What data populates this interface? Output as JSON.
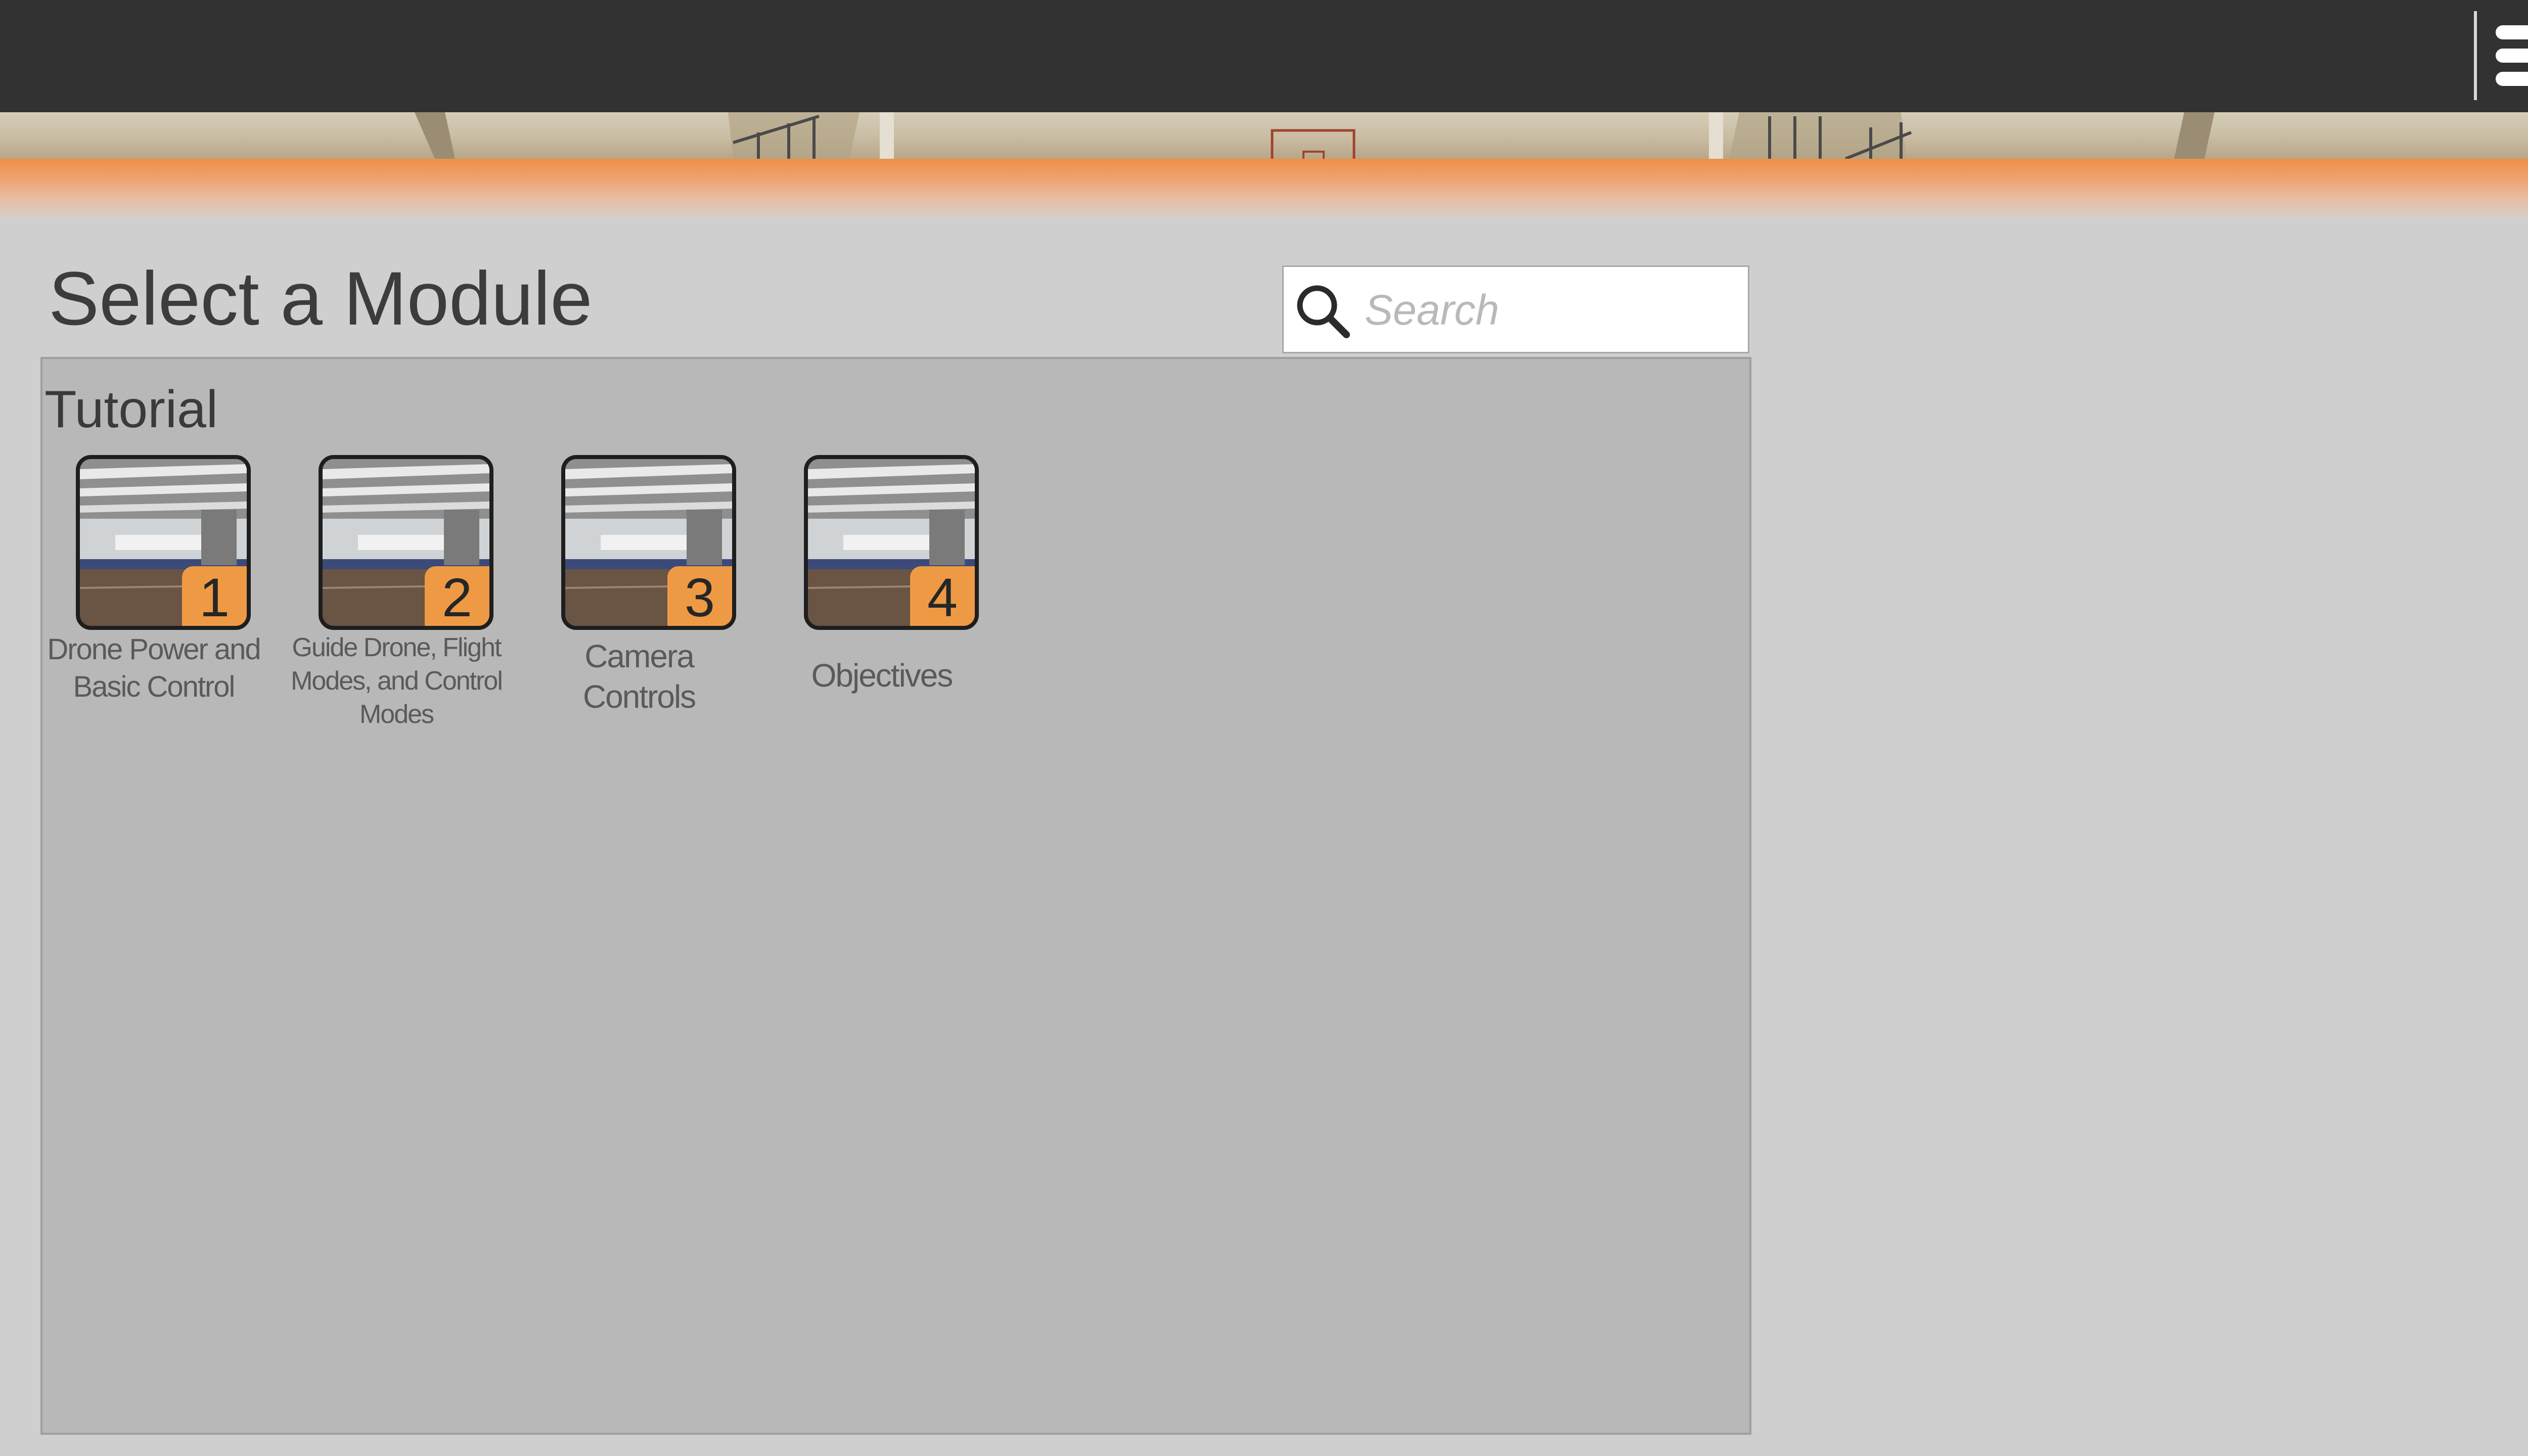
{
  "topbar": {
    "menu_icon": "hamburger-menu-icon"
  },
  "page": {
    "title": "Select a Module"
  },
  "search": {
    "placeholder": "Search",
    "value": "",
    "icon": "search-icon"
  },
  "section": {
    "title": "Tutorial"
  },
  "modules": [
    {
      "number": "1",
      "title": "Drone Power and Basic Control"
    },
    {
      "number": "2",
      "title": "Guide Drone, Flight Modes, and Control Modes"
    },
    {
      "number": "3",
      "title": "Camera Controls"
    },
    {
      "number": "4",
      "title": "Objectives"
    }
  ],
  "colors": {
    "topbar": "#323232",
    "accent_orange": "#ee9a45",
    "panel": "#b8b8b8",
    "background": "#cfcfcf"
  }
}
